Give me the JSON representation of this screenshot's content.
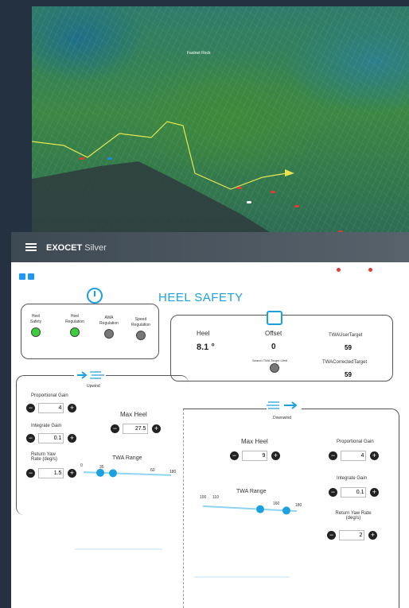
{
  "map": {
    "label": "Fastnet Rock"
  },
  "header": {
    "brand": "EXOCET",
    "edition": "Silver"
  },
  "title": "HEEL SAFETY",
  "status": {
    "items": [
      {
        "label": "Heel Safety",
        "state": "green"
      },
      {
        "label": "Heel Regulation",
        "state": "green"
      },
      {
        "label": "AWA Regulation",
        "state": "gray"
      },
      {
        "label": "Speed Regulation",
        "state": "gray"
      }
    ]
  },
  "readout": {
    "heel_label": "Heel",
    "heel_value": "8.1 °",
    "offset_label": "Offset",
    "offset_value": "0",
    "search_label": "Search TWA Target Limit",
    "twa_user_label": "TWAUserTarget",
    "twa_user_value": "59",
    "twa_corr_label": "TWACorrectedTarget",
    "twa_corr_value": "59"
  },
  "upwind": {
    "label": "Upwind",
    "prop_gain_label": "Proportional Gain",
    "prop_gain": "4",
    "int_gain_label": "Integrate Gain",
    "int_gain": "0.1",
    "yaw_label": "Return Yaw Rate (deg/s)",
    "yaw": "1.5",
    "max_heel_label": "Max Heel",
    "max_heel": "27.5",
    "twa_label": "TWA Range",
    "twa_ticks": [
      "0",
      "35",
      "60",
      "180"
    ],
    "twa_low": 35,
    "twa_high": 60,
    "twa_max": 180
  },
  "downwind": {
    "label": "Downwind",
    "prop_gain_label": "Proportional Gain",
    "prop_gain": "4",
    "int_gain_label": "Integrate Gain",
    "int_gain": "0.1",
    "yaw_label": "Return Yaw Rate (deg/s)",
    "yaw": "2",
    "max_heel_label": "Max Heel",
    "max_heel": "9",
    "twa_label": "TWA Range",
    "twa_ticks": [
      "100",
      "110",
      "160",
      "180"
    ],
    "twa_low": 110,
    "twa_high": 160,
    "twa_max": 180
  }
}
